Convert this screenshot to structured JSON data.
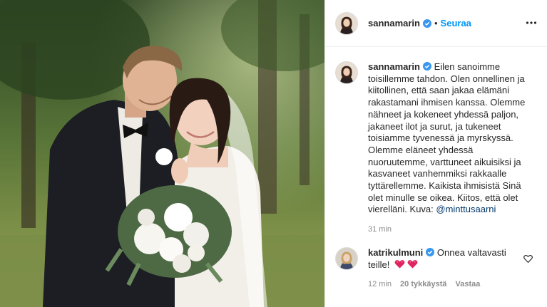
{
  "post": {
    "author": "sannamarin",
    "follow_label": "Seuraa",
    "separator": "•",
    "more_icon": "more-horizontal-icon",
    "photo_description": "Wedding photo of a couple in a green park"
  },
  "caption": {
    "author": "sannamarin",
    "text": "Eilen sanoimme toisillemme tahdon. Olen onnellinen ja kiitollinen, että saan jakaa elämäni rakastamani ihmisen kanssa. Olemme nähneet ja kokeneet yhdessä paljon, jakaneet ilot ja surut, ja tukeneet toisiamme tyvenessä ja myrskyssä. Olemme eläneet yhdessä nuoruutemme, varttuneet aikuisiksi ja kasvaneet vanhemmiksi rakkaalle tyttärellemme. Kaikista ihmisistä Sinä olet minulle se oikea. Kiitos, että olet vierelläni. Kuva: ",
    "mention": "@minttusaarni",
    "time": "31 min"
  },
  "comment": {
    "author": "katrikulmuni",
    "text": "Onnea valtavasti teille!",
    "time": "12 min",
    "likes": "20 tykkäystä",
    "reply_label": "Vastaa"
  },
  "colors": {
    "link": "#0095f6",
    "mention": "#00376b",
    "muted": "#8e8e8e",
    "verified": "#3897f0"
  }
}
